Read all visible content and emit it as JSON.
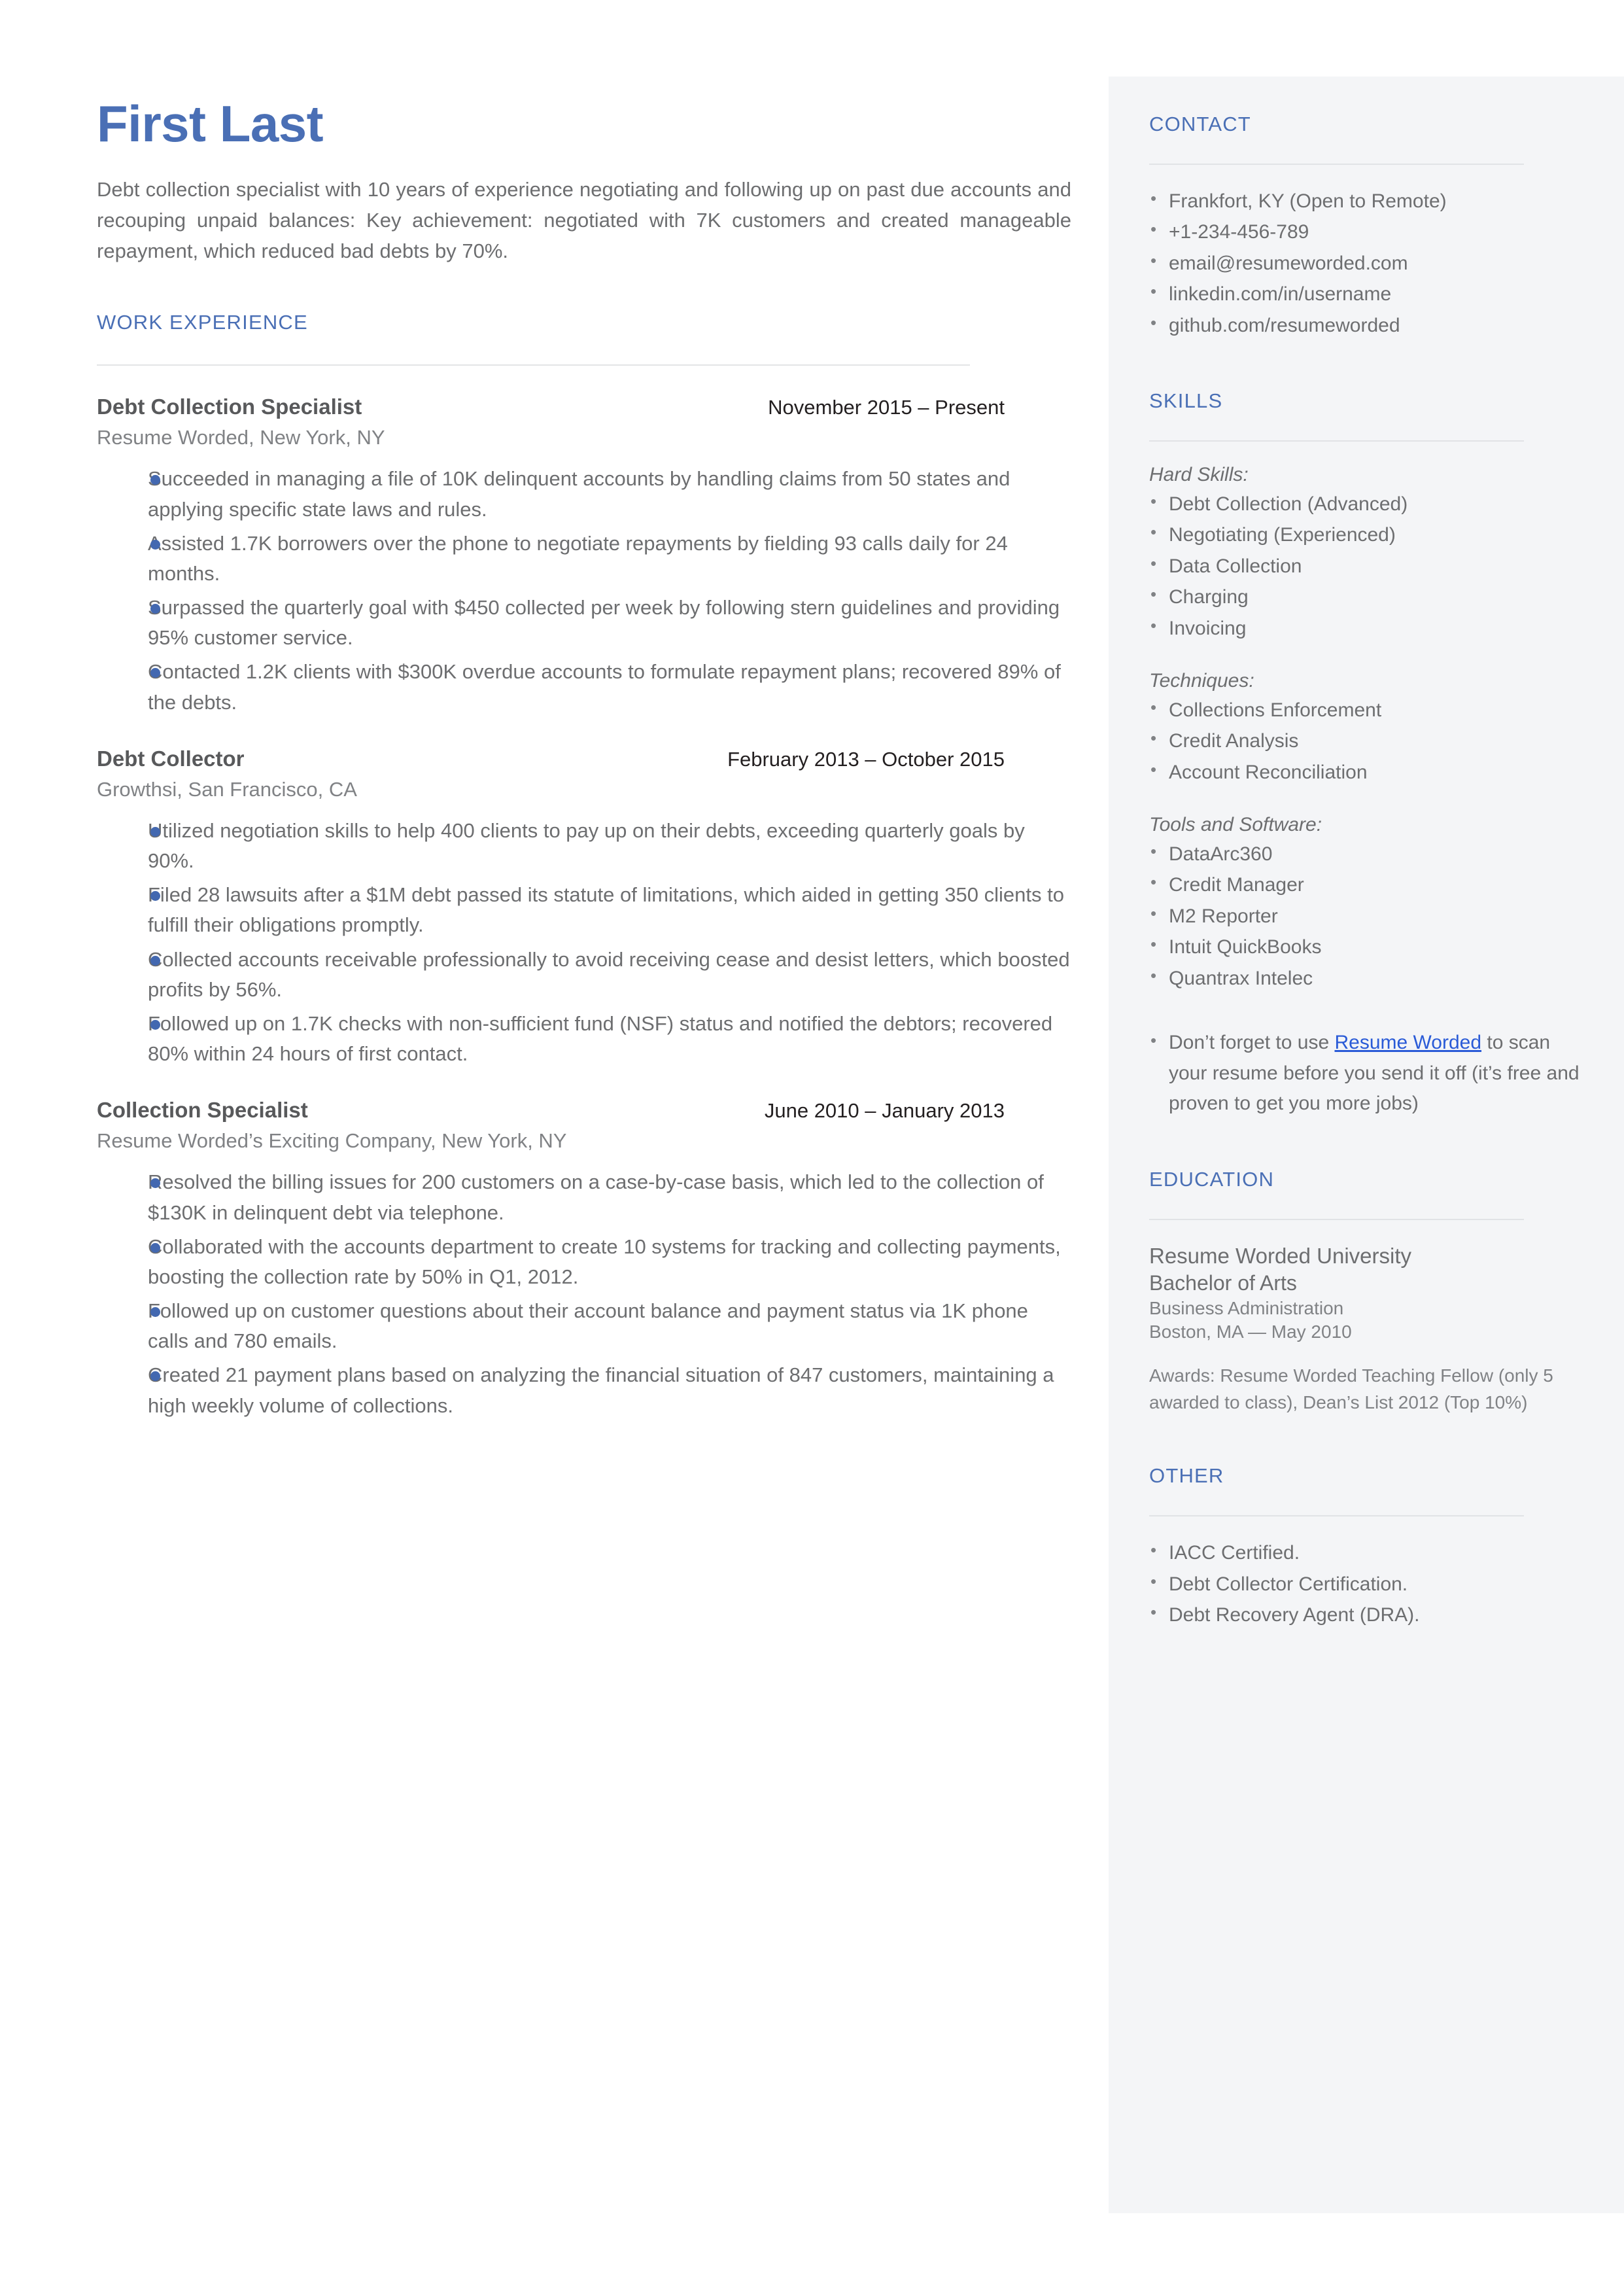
{
  "header": {
    "name": "First Last",
    "summary": "Debt collection specialist with 10 years of experience negotiating and following up on past due accounts and recouping unpaid balances: Key achievement: negotiated with 7K customers and created manageable repayment, which reduced bad debts by 70%."
  },
  "work": {
    "section_label": "WORK EXPERIENCE",
    "jobs": [
      {
        "title": "Debt Collection Specialist",
        "dates": "November 2015 – Present",
        "company": "Resume Worded, New York, NY",
        "bullets": [
          "Succeeded in managing a file of 10K delinquent accounts by handling claims from 50 states and applying specific state laws and rules.",
          "Assisted 1.7K borrowers over the phone to negotiate repayments by fielding 93 calls daily for 24 months.",
          "Surpassed the quarterly goal with $450 collected per week by following stern guidelines and providing 95% customer service.",
          "Contacted 1.2K clients with $300K overdue accounts to formulate repayment plans; recovered 89% of the debts."
        ]
      },
      {
        "title": "Debt Collector",
        "dates": "February 2013 – October 2015",
        "company": "Growthsi, San Francisco, CA",
        "bullets": [
          "Utilized negotiation skills to help 400 clients to pay up on their debts, exceeding quarterly goals by 90%.",
          "Filed 28 lawsuits after a $1M debt passed its statute of limitations, which aided in getting 350 clients to fulfill their obligations promptly.",
          "Collected accounts receivable professionally to avoid receiving cease and desist letters, which boosted profits by 56%.",
          "Followed up on 1.7K checks with non-sufficient fund (NSF) status and notified the debtors; recovered 80% within 24 hours of first contact."
        ]
      },
      {
        "title": "Collection Specialist",
        "dates": "June 2010 – January 2013",
        "company": "Resume Worded’s Exciting Company, New York, NY",
        "bullets": [
          "Resolved the billing issues for 200 customers on a case-by-case basis, which led to the collection of  $130K in delinquent debt via telephone.",
          "Collaborated with the accounts department to create 10 systems for tracking and collecting payments, boosting the collection rate by 50% in Q1, 2012.",
          "Followed up on customer questions about their account balance and payment status via 1K phone calls and 780 emails.",
          "Created 21 payment plans based on analyzing the financial situation of 847 customers, maintaining a high weekly volume of collections."
        ]
      }
    ]
  },
  "sidebar": {
    "contact": {
      "label": "CONTACT",
      "items": [
        "Frankfort, KY (Open to Remote)",
        "+1-234-456-789",
        "email@resumeworded.com",
        "linkedin.com/in/username",
        "github.com/resumeworded"
      ]
    },
    "skills": {
      "label": "SKILLS",
      "groups": [
        {
          "heading": "Hard Skills:",
          "items": [
            "Debt Collection (Advanced)",
            "Negotiating (Experienced)",
            "Data Collection",
            "Charging",
            "Invoicing"
          ]
        },
        {
          "heading": "Techniques:",
          "items": [
            "Collections Enforcement",
            "Credit Analysis",
            "Account Reconciliation"
          ]
        },
        {
          "heading": "Tools and Software:",
          "items": [
            "DataArc360",
            "Credit Manager",
            "M2 Reporter",
            "Intuit QuickBooks",
            "Quantrax Intelec"
          ]
        }
      ],
      "note_before_link": "Don’t forget to use ",
      "note_link": "Resume Worded",
      "note_after_link": " to scan your resume before you send it off (it’s free and proven to get you more jobs)"
    },
    "education": {
      "label": "EDUCATION",
      "school": "Resume Worded University",
      "degree": "Bachelor of Arts",
      "field": "Business Administration",
      "place": "Boston, MA — May 2010",
      "awards": "Awards: Resume Worded Teaching Fellow (only 5 awarded to class), Dean’s List 2012 (Top 10%)"
    },
    "other": {
      "label": "OTHER",
      "items": [
        "IACC Certified.",
        "Debt Collector Certification.",
        "Debt Recovery Agent (DRA)."
      ]
    }
  },
  "colors": {
    "accent_blue": "#4a6fb5",
    "bullet_blue": "#4368b0",
    "link_blue": "#2a5bd7",
    "sidebar_bg": "#f4f5f7",
    "body_text": "#6d6e70"
  }
}
